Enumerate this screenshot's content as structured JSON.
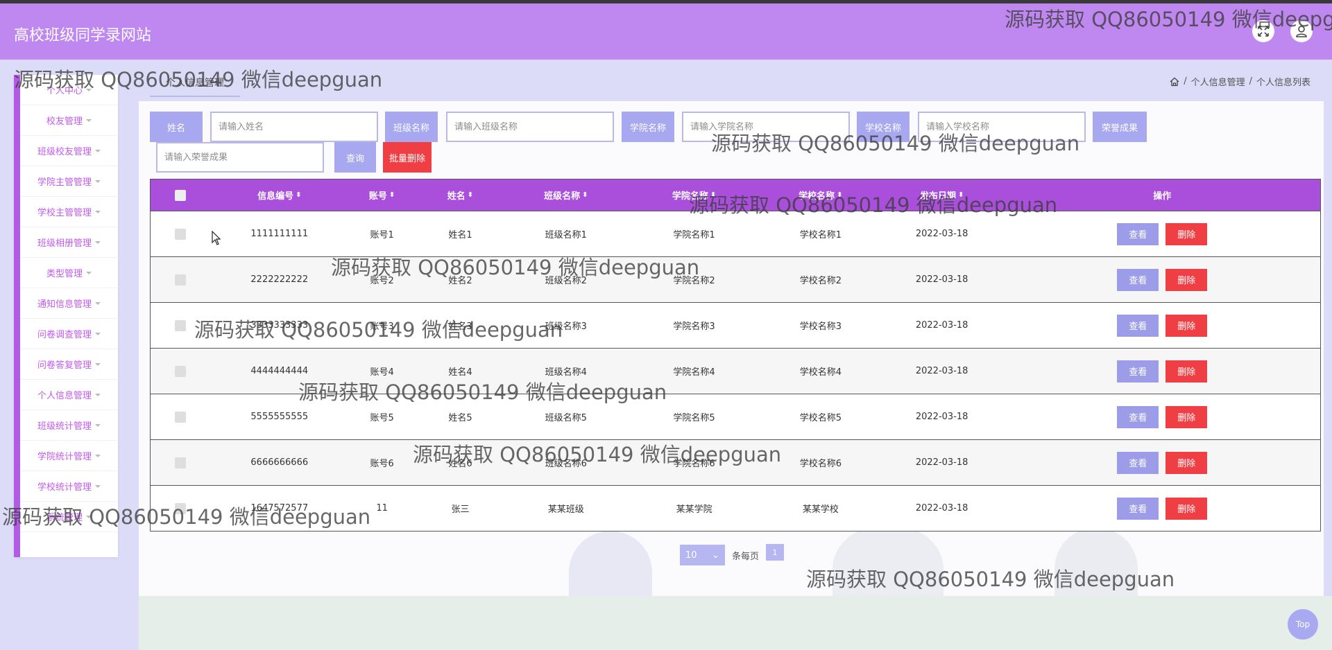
{
  "app": {
    "title": "高校班级同学录网站"
  },
  "sidebar": {
    "items": [
      {
        "label": "个人中心"
      },
      {
        "label": "校友管理"
      },
      {
        "label": "班级校友管理"
      },
      {
        "label": "学院主管管理"
      },
      {
        "label": "学校主管管理"
      },
      {
        "label": "班级相册管理"
      },
      {
        "label": "类型管理"
      },
      {
        "label": "通知信息管理"
      },
      {
        "label": "问卷调查管理"
      },
      {
        "label": "问卷答复管理"
      },
      {
        "label": "个人信息管理"
      },
      {
        "label": "班级统计管理"
      },
      {
        "label": "学院统计管理"
      },
      {
        "label": "学校统计管理"
      },
      {
        "label": "系统管理"
      }
    ]
  },
  "tab": {
    "label": "个人信息管理"
  },
  "breadcrumb": {
    "items": [
      "个人信息管理",
      "个人信息列表"
    ],
    "separator": "/"
  },
  "search": {
    "name_label": "姓名",
    "name_placeholder": "请输入姓名",
    "class_label": "班级名称",
    "class_placeholder": "请输入班级名称",
    "college_label": "学院名称",
    "college_placeholder": "请输入学院名称",
    "school_label": "学校名称",
    "school_placeholder": "请输入学校名称",
    "honor_label": "荣誉成果",
    "honor_placeholder": "请输入荣誉成果",
    "query_button": "查询",
    "batch_delete_button": "批量删除"
  },
  "table": {
    "headers": [
      "信息编号",
      "账号",
      "姓名",
      "班级名称",
      "学院名称",
      "学校名称",
      "发布日期",
      "操作"
    ],
    "view_label": "查看",
    "delete_label": "删除",
    "rows": [
      {
        "id": "1111111111",
        "account": "账号1",
        "name": "姓名1",
        "class": "班级名称1",
        "college": "学院名称1",
        "school": "学校名称1",
        "date": "2022-03-18"
      },
      {
        "id": "2222222222",
        "account": "账号2",
        "name": "姓名2",
        "class": "班级名称2",
        "college": "学院名称2",
        "school": "学校名称2",
        "date": "2022-03-18"
      },
      {
        "id": "3333333333",
        "account": "账号3",
        "name": "姓名3",
        "class": "班级名称3",
        "college": "学院名称3",
        "school": "学校名称3",
        "date": "2022-03-18"
      },
      {
        "id": "4444444444",
        "account": "账号4",
        "name": "姓名4",
        "class": "班级名称4",
        "college": "学院名称4",
        "school": "学校名称4",
        "date": "2022-03-18"
      },
      {
        "id": "5555555555",
        "account": "账号5",
        "name": "姓名5",
        "class": "班级名称5",
        "college": "学院名称5",
        "school": "学校名称5",
        "date": "2022-03-18"
      },
      {
        "id": "6666666666",
        "account": "账号6",
        "name": "姓名6",
        "class": "班级名称6",
        "college": "学院名称6",
        "school": "学校名称6",
        "date": "2022-03-18"
      },
      {
        "id": "1647572577",
        "account": "11",
        "name": "张三",
        "class": "某某班级",
        "college": "某某学院",
        "school": "某某学校",
        "date": "2022-03-18"
      }
    ]
  },
  "pagination": {
    "page_size": "10",
    "per_page_label": "条每页",
    "current_page": "1"
  },
  "back_to_top": {
    "label": "Top"
  },
  "watermark": {
    "text": "源码获取 QQ86050149 微信deepguan"
  },
  "colors": {
    "header": "#bf87f0",
    "primary": "#a8a8f0",
    "table_header": "#a94fdc",
    "danger": "#ef3f44",
    "sidebar_text": "#c35af0"
  }
}
